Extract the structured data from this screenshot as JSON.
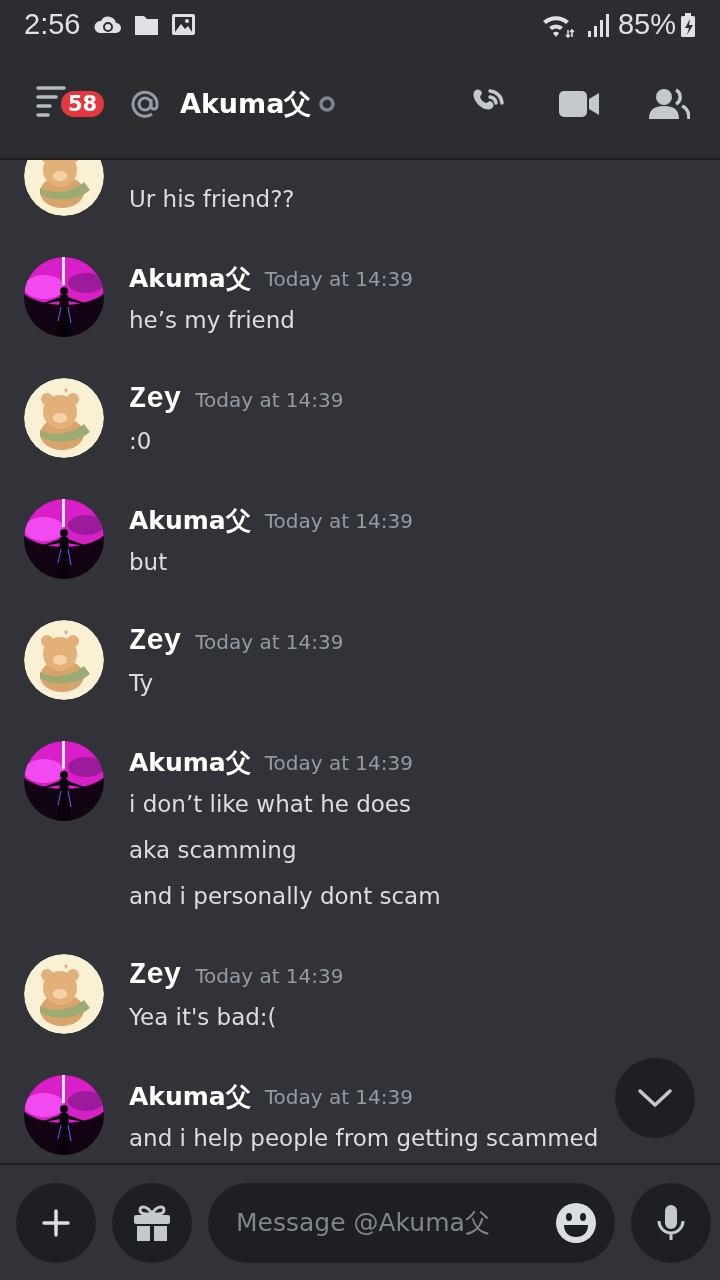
{
  "status_bar": {
    "time": "2:56",
    "battery": "85%"
  },
  "header": {
    "unread_badge": "58",
    "title": "Akuma父"
  },
  "messages": [
    {
      "kind": "bear",
      "lines": [
        "Ur his friend??"
      ]
    },
    {
      "kind": "silhouette",
      "author": "Akuma父",
      "time": "Today at 14:39",
      "lines": [
        "he’s my friend"
      ]
    },
    {
      "kind": "bear",
      "author": "Zey",
      "time": "Today at 14:39",
      "lines": [
        ":0"
      ]
    },
    {
      "kind": "silhouette",
      "author": "Akuma父",
      "time": "Today at 14:39",
      "lines": [
        "but"
      ]
    },
    {
      "kind": "bear",
      "author": "Zey",
      "time": "Today at 14:39",
      "lines": [
        "Ty"
      ]
    },
    {
      "kind": "silhouette",
      "author": "Akuma父",
      "time": "Today at 14:39",
      "lines": [
        "i don’t like what he does",
        "aka scamming",
        "and i personally dont scam"
      ]
    },
    {
      "kind": "bear",
      "author": "Zey",
      "time": "Today at 14:39",
      "lines": [
        "Yea it's bad:("
      ]
    },
    {
      "kind": "silhouette",
      "author": "Akuma父",
      "time": "Today at 14:39",
      "lines": [
        "and i help people from getting scammed"
      ]
    }
  ],
  "composer": {
    "placeholder": "Message @Akuma父"
  }
}
